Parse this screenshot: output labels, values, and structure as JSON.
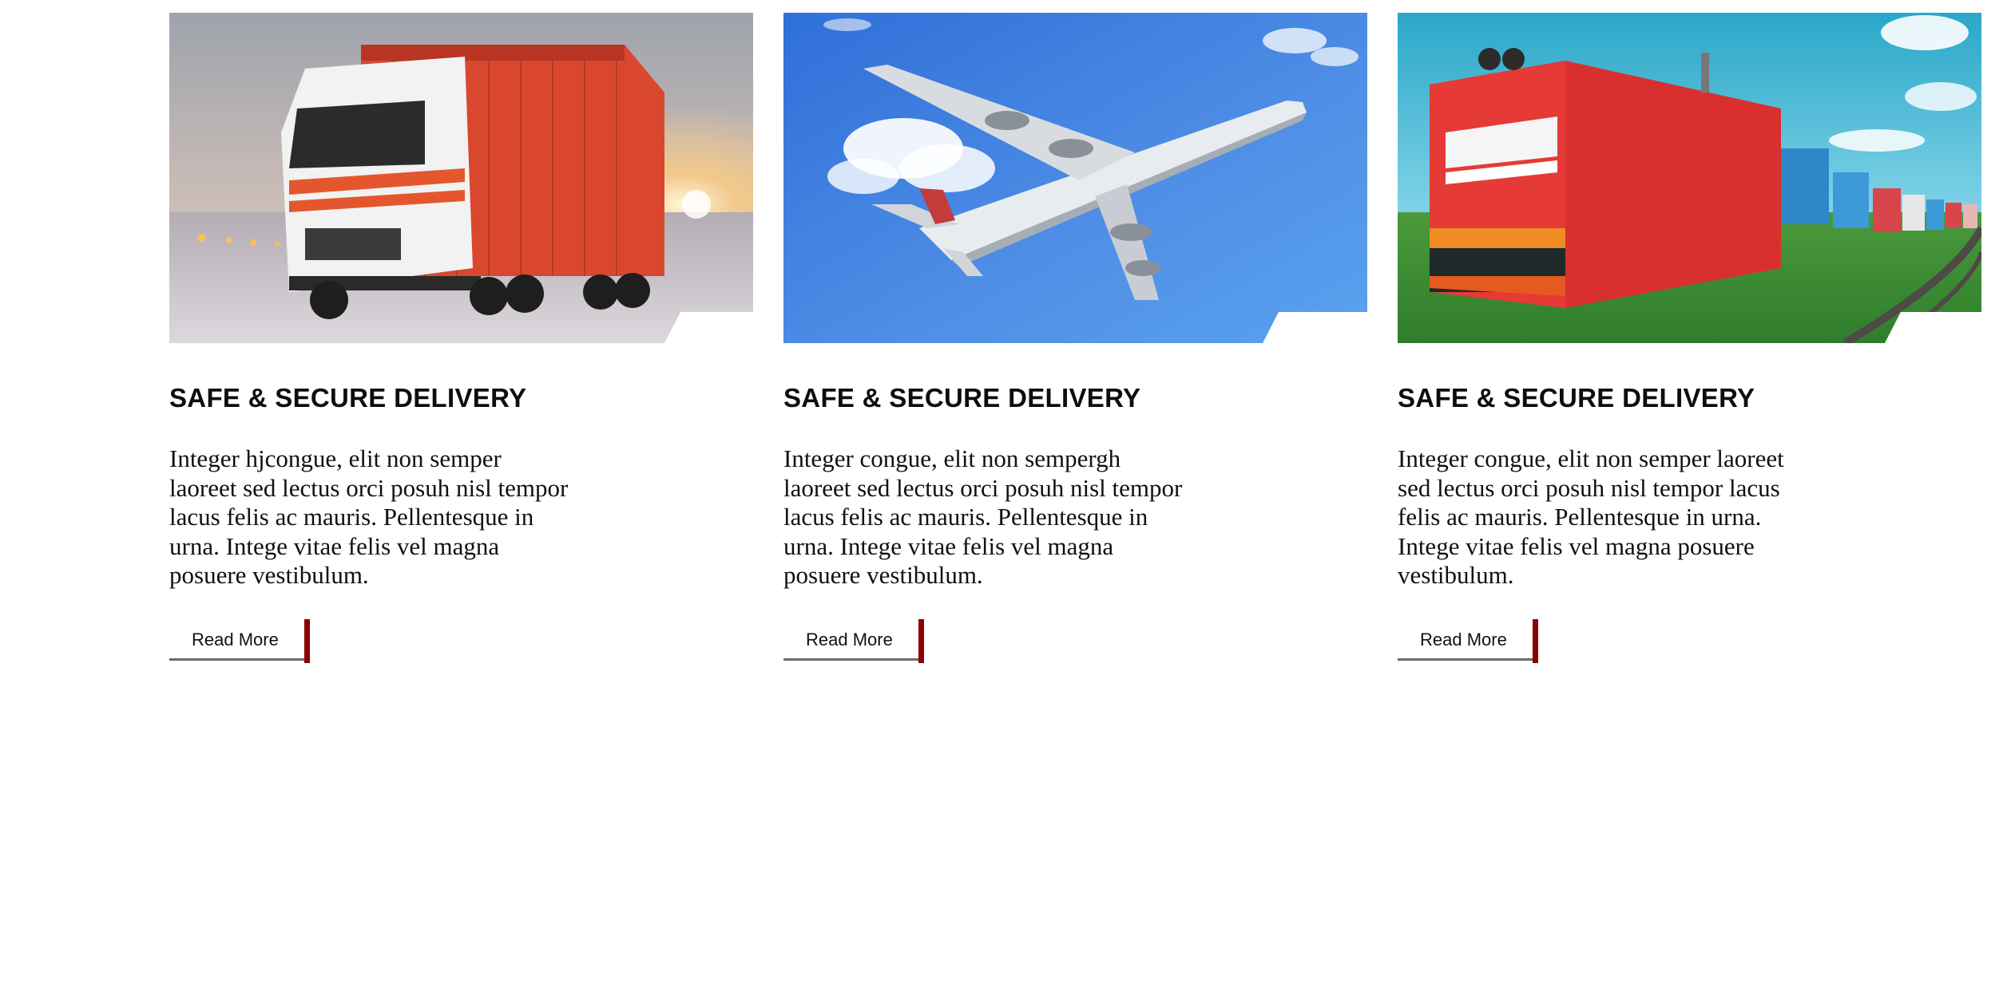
{
  "cards": [
    {
      "image_icon": "truck-image",
      "title": "SAFE & SECURE DELIVERY",
      "text": "Integer hjcongue, elit non semper laoreet sed lectus orci posuh nisl tempor lacus felis ac mauris. Pellentesque in urna. Intege vitae felis vel magna posuere vestibulum.",
      "button_label": "Read More"
    },
    {
      "image_icon": "airplane-image",
      "title": "SAFE & SECURE DELIVERY",
      "text": "Integer congue, elit non sempergh laoreet sed lectus orci posuh nisl tempor lacus felis ac mauris. Pellentesque in urna. Intege vitae felis vel magna posuere vestibulum.",
      "button_label": "Read More"
    },
    {
      "image_icon": "train-image",
      "title": "SAFE & SECURE DELIVERY",
      "text": "Integer congue, elit non semper laoreet sed lectus orci posuh nisl tempor lacus felis ac mauris. Pellentesque in urna. Intege vitae felis vel magna posuere vestibulum.",
      "button_label": "Read More"
    }
  ],
  "colors": {
    "accent": "#8b0000",
    "underline": "#6d6d6d"
  }
}
